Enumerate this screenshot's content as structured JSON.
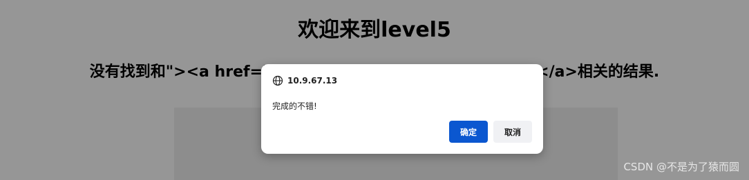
{
  "page": {
    "title": "欢迎来到level5",
    "result_text": "没有找到和\"><a href=javascript:alert(/xss/)>click me!</a>相关的结果."
  },
  "dialog": {
    "origin": "10.9.67.13",
    "message": "完成的不错!",
    "ok_label": "确定",
    "cancel_label": "取消",
    "ok_color": "#0b57d0"
  },
  "watermark": "CSDN @不是为了猿而圆",
  "icons": {
    "site": "globe-icon"
  }
}
